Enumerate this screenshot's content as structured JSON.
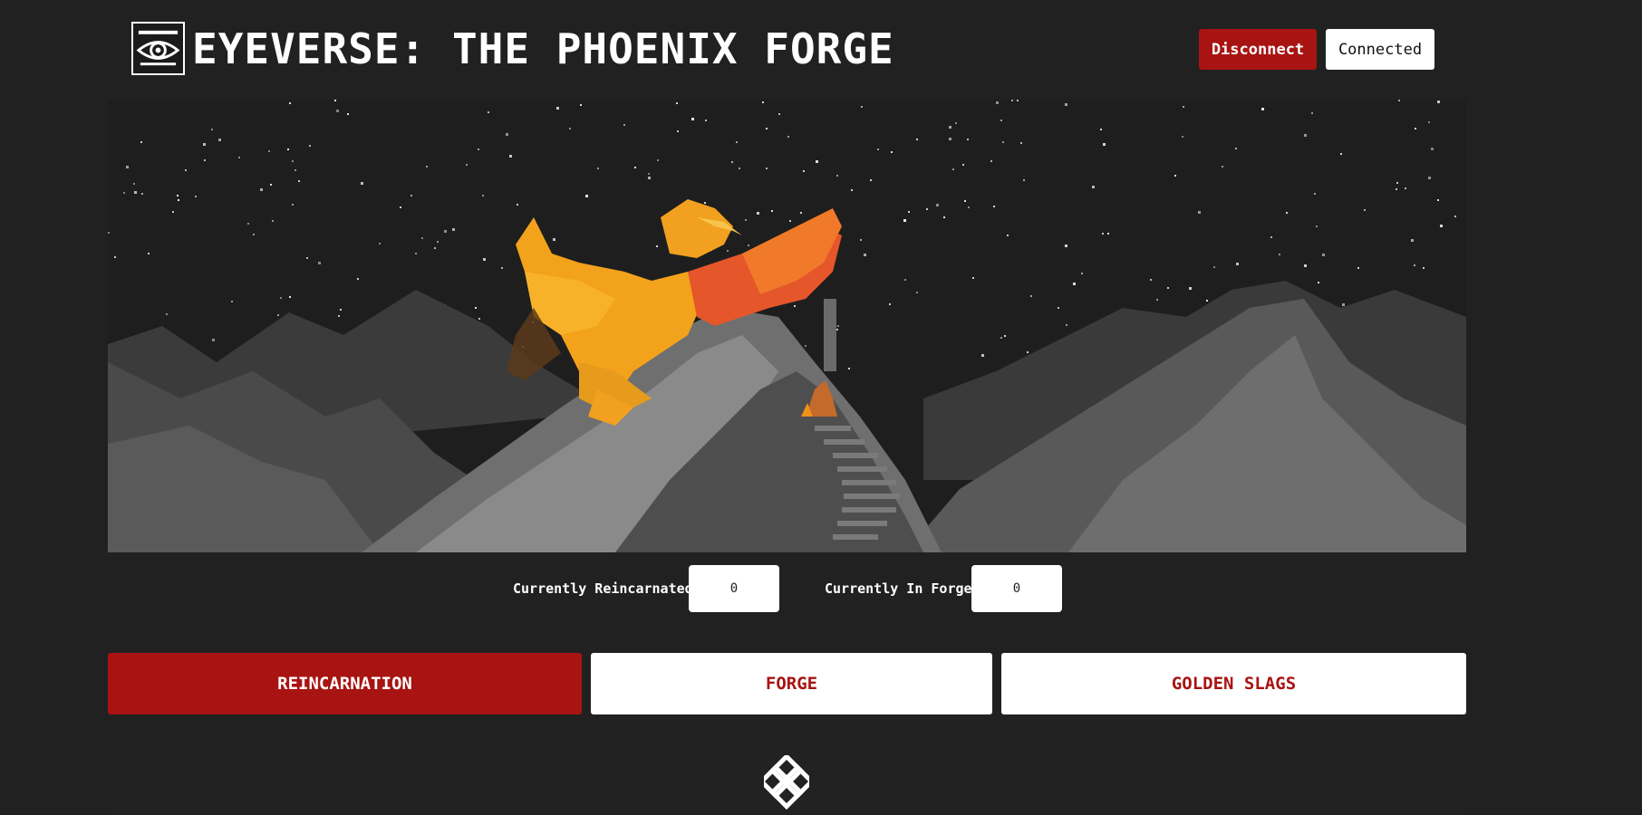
{
  "header": {
    "logo_icon": "eye-icon",
    "title": "EYEVERSE: THE PHOENIX FORGE",
    "disconnect_label": "Disconnect",
    "connected_label": "Connected"
  },
  "hero": {
    "image": "phoenix-over-mountains-pixel-art"
  },
  "stats": {
    "reincarnated_label": "Currently Reincarnated:",
    "reincarnated_value": "0",
    "in_forge_label": "Currently In Forge:",
    "in_forge_value": "0"
  },
  "tabs": [
    {
      "label": "REINCARNATION",
      "active": true
    },
    {
      "label": "FORGE",
      "active": false
    },
    {
      "label": "GOLDEN SLAGS",
      "active": false
    }
  ],
  "panel": {
    "icon": "endless-knot-icon"
  },
  "colors": {
    "background": "#212121",
    "accent_red": "#a81412",
    "white": "#ffffff",
    "phoenix_orange": "#f0901c"
  }
}
